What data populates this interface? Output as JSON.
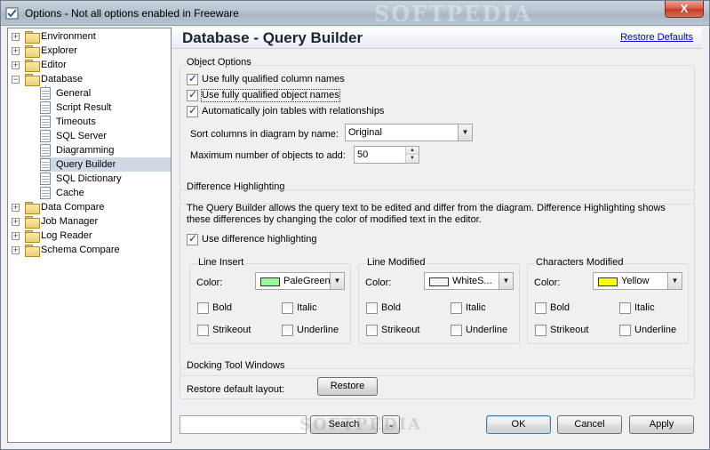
{
  "window": {
    "title": "Options - Not all options enabled in Freeware",
    "watermark": "SOFTPEDIA",
    "close_label": "X"
  },
  "tree": {
    "items": [
      {
        "label": "Environment",
        "expander": "+"
      },
      {
        "label": "Explorer",
        "expander": "+"
      },
      {
        "label": "Editor",
        "expander": "+"
      },
      {
        "label": "Database",
        "expander": "−"
      },
      {
        "label": "General"
      },
      {
        "label": "Script Result"
      },
      {
        "label": "Timeouts"
      },
      {
        "label": "SQL Server"
      },
      {
        "label": "Diagramming"
      },
      {
        "label": "Query Builder",
        "selected": true
      },
      {
        "label": "SQL Dictionary"
      },
      {
        "label": "Cache"
      },
      {
        "label": "Data Compare",
        "expander": "+"
      },
      {
        "label": "Job Manager",
        "expander": "+"
      },
      {
        "label": "Log Reader",
        "expander": "+"
      },
      {
        "label": "Schema Compare",
        "expander": "+"
      }
    ]
  },
  "header": {
    "title": "Database - Query Builder",
    "restore_defaults": "Restore Defaults"
  },
  "object_options": {
    "title": "Object Options",
    "checkboxes": [
      {
        "label": "Use fully qualified column names",
        "checked": true
      },
      {
        "label": "Use fully qualified object names",
        "checked": true
      },
      {
        "label": "Automatically join tables with relationships",
        "checked": true
      }
    ],
    "sort_label": "Sort columns in diagram by name:",
    "sort_value": "Original",
    "max_label": "Maximum number of objects to add:",
    "max_value": "50"
  },
  "difference": {
    "title": "Difference Highlighting",
    "description": "The Query Builder allows the query text to be edited and differ from the diagram. Difference Highlighting shows these differences by changing the color of modified text in the editor.",
    "use_label": "Use difference highlighting",
    "use_checked": true,
    "color_label": "Color:",
    "groups": [
      {
        "title": "Line Insert",
        "color_name": "PaleGreen",
        "color_hex": "#98fb98",
        "bold": "Bold",
        "italic": "Italic",
        "strikeout": "Strikeout",
        "underline": "Underline"
      },
      {
        "title": "Line Modified",
        "color_name": "WhiteS...",
        "color_hex": "#f5f5f5",
        "bold": "Bold",
        "italic": "Italic",
        "strikeout": "Strikeout",
        "underline": "Underline"
      },
      {
        "title": "Characters Modified",
        "color_name": "Yellow",
        "color_hex": "#ffff00",
        "bold": "Bold",
        "italic": "Italic",
        "strikeout": "Strikeout",
        "underline": "Underline"
      }
    ]
  },
  "docking": {
    "title": "Docking Tool Windows",
    "restore_label": "Restore default layout:",
    "restore_button": "Restore"
  },
  "footer": {
    "search_button": "Search",
    "ok": "OK",
    "cancel": "Cancel",
    "apply": "Apply",
    "watermark": "SOFTPEDIA"
  }
}
